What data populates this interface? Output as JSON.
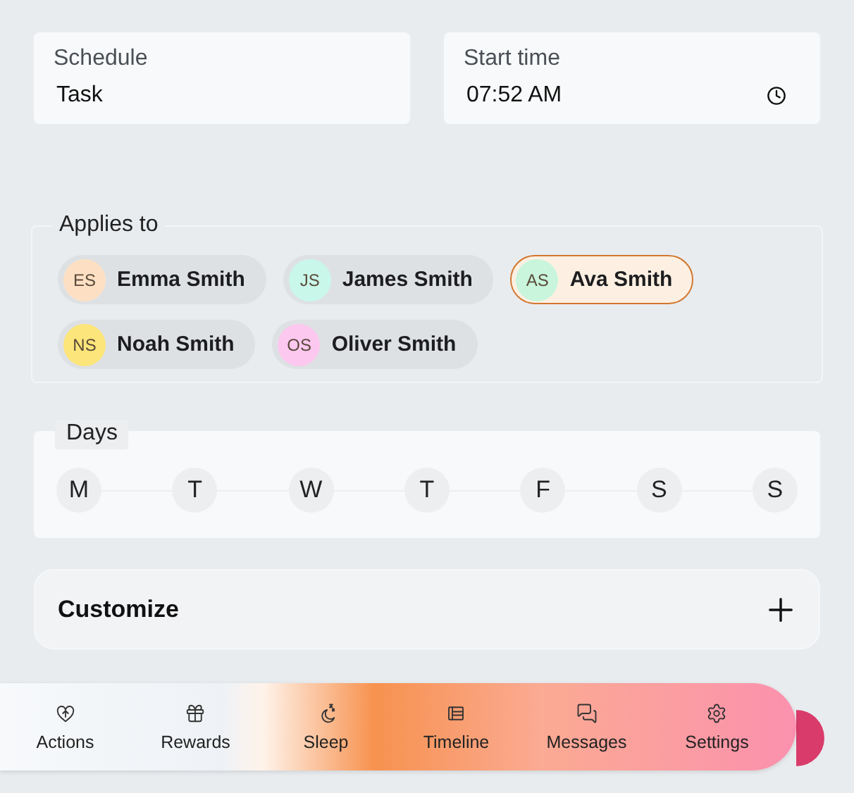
{
  "schedule": {
    "label": "Schedule",
    "value": "Task"
  },
  "start_time": {
    "label": "Start time",
    "value": "07:52 AM"
  },
  "applies_to": {
    "label": "Applies to",
    "people": [
      {
        "initials": "ES",
        "name": "Emma Smith",
        "color": "#fde0c4",
        "selected": false
      },
      {
        "initials": "JS",
        "name": "James Smith",
        "color": "#c9f7ea",
        "selected": false
      },
      {
        "initials": "AS",
        "name": "Ava Smith",
        "color": "#c8f5dc",
        "selected": true
      },
      {
        "initials": "NS",
        "name": "Noah Smith",
        "color": "#fce57a",
        "selected": false
      },
      {
        "initials": "OS",
        "name": "Oliver Smith",
        "color": "#fcc8ef",
        "selected": false
      }
    ]
  },
  "days": {
    "label": "Days",
    "items": [
      {
        "label": "M",
        "selected": false
      },
      {
        "label": "T",
        "selected": false
      },
      {
        "label": "W",
        "selected": false
      },
      {
        "label": "T",
        "selected": false
      },
      {
        "label": "F",
        "selected": false
      },
      {
        "label": "S",
        "selected": false
      },
      {
        "label": "S",
        "selected": false
      }
    ]
  },
  "customize": {
    "label": "Customize",
    "expanded": false
  },
  "nav": [
    {
      "kind": "actions",
      "label": "Actions"
    },
    {
      "kind": "rewards",
      "label": "Rewards"
    },
    {
      "kind": "sleep",
      "label": "Sleep"
    },
    {
      "kind": "timeline",
      "label": "Timeline"
    },
    {
      "kind": "messages",
      "label": "Messages"
    },
    {
      "kind": "settings",
      "label": "Settings"
    }
  ]
}
